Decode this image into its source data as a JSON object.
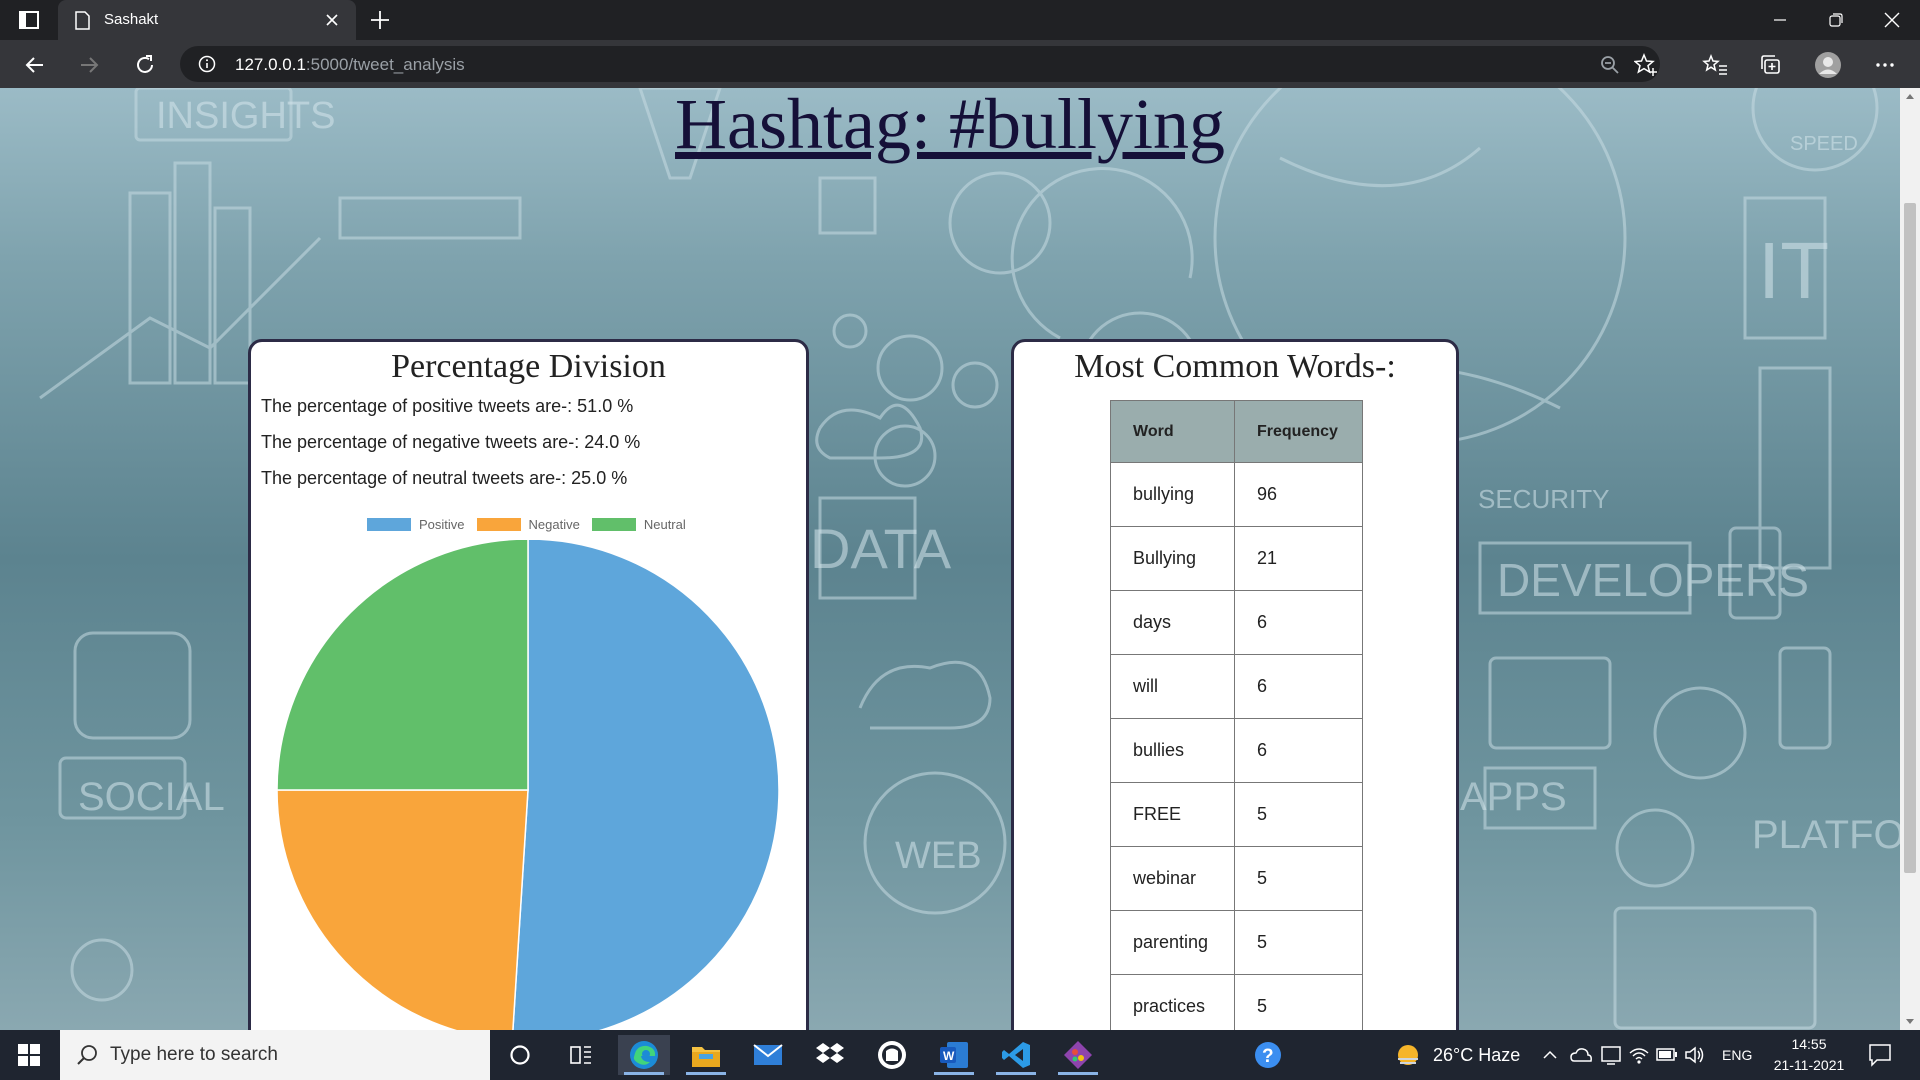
{
  "browser": {
    "tab_title": "Sashakt",
    "url_host": "127.0.0.1",
    "url_rest": ":5000/tweet_analysis"
  },
  "page": {
    "heading": "Hashtag: #bullying",
    "background_words": [
      "INSIGHTS",
      "DATA",
      "SOCIAL",
      "WEB",
      "SECURITY",
      "DEVELOPERS",
      "APPS",
      "PLATFORM",
      "IT",
      "SPEED"
    ],
    "percentage_card": {
      "title": "Percentage Division",
      "positive_text": "The percentage of positive tweets are-: 51.0 %",
      "negative_text": "The percentage of negative tweets are-: 24.0 %",
      "neutral_text": "The percentage of neutral tweets are-: 25.0 %"
    },
    "words_card": {
      "title": "Most Common Words-:",
      "headers": [
        "Word",
        "Frequency"
      ],
      "rows": [
        [
          "bullying",
          "96"
        ],
        [
          "Bullying",
          "21"
        ],
        [
          "days",
          "6"
        ],
        [
          "will",
          "6"
        ],
        [
          "bullies",
          "6"
        ],
        [
          "FREE",
          "5"
        ],
        [
          "webinar",
          "5"
        ],
        [
          "parenting",
          "5"
        ],
        [
          "practices",
          "5"
        ]
      ]
    }
  },
  "chart_data": {
    "type": "pie",
    "labels": [
      "Positive",
      "Negative",
      "Neutral"
    ],
    "values": [
      51.0,
      24.0,
      25.0
    ],
    "colors": [
      "#5ea6db",
      "#f9a53b",
      "#61bf6a"
    ],
    "legend": "top"
  },
  "taskbar": {
    "search_placeholder": "Type here to search",
    "weather": "26°C  Haze",
    "language": "ENG",
    "time": "14:55",
    "date": "21-11-2021"
  },
  "icons": [
    "window-menu-icon",
    "page-icon",
    "close-icon",
    "plus-icon",
    "minimize-icon",
    "restore-icon",
    "back-arrow-icon",
    "forward-arrow-icon",
    "reload-icon",
    "info-icon",
    "zoom-icon",
    "favorite-add-icon",
    "favorites-icon",
    "collections-icon",
    "profile-icon",
    "more-icon",
    "windows-logo-icon",
    "search-icon",
    "cortana-icon",
    "task-view-icon",
    "edge-icon",
    "file-explorer-icon",
    "mail-icon",
    "dropbox-icon",
    "github-desktop-icon",
    "word-icon",
    "vscode-icon",
    "git-icon",
    "help-icon",
    "weather-icon",
    "notification-icon"
  ]
}
